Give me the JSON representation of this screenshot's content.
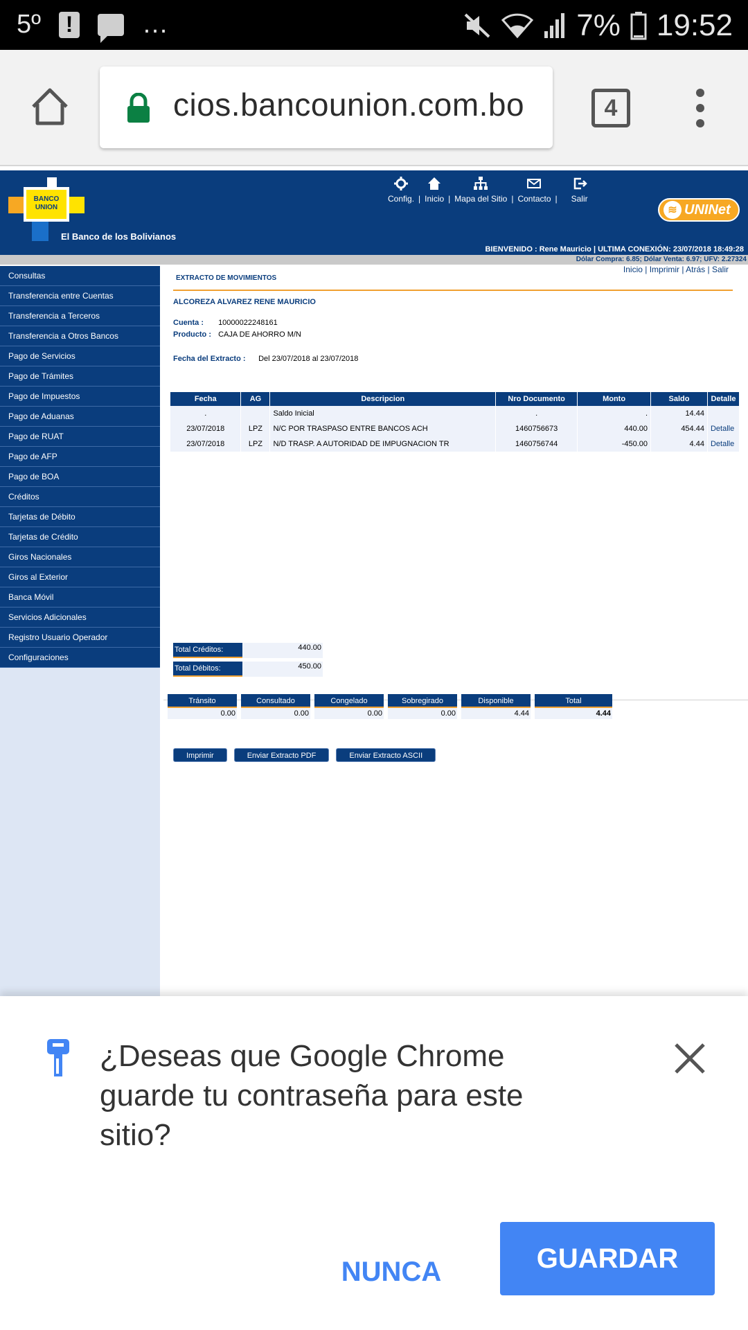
{
  "status_bar": {
    "left_text": "5º",
    "ellipsis": "…",
    "battery": "7%",
    "time": "19:52"
  },
  "chrome": {
    "url": "cios.bancounion.com.bo",
    "tab_count": "4"
  },
  "bank": {
    "logo_text": "BANCO UNION",
    "tagline": "El Banco de los Bolivianos",
    "nav": [
      {
        "label": "Config.",
        "sep": "|"
      },
      {
        "label": "Inicio",
        "sep": "|"
      },
      {
        "label": "Mapa del Sitio",
        "sep": "|"
      },
      {
        "label": "Contacto",
        "sep": "|"
      },
      {
        "label": "Salir",
        "sep": ""
      }
    ],
    "uninet": "UNINet",
    "welcome": "BIENVENIDO : Rene Mauricio | ULTIMA CONEXIÓN: 23/07/2018 18:49:28",
    "rates": "Dólar Compra: 6.85; Dólar Venta: 6.97; UFV: 2.27324",
    "sidebar": [
      "Consultas",
      "Transferencia entre Cuentas",
      "Transferencia a Terceros",
      "Transferencia a Otros Bancos",
      "Pago de Servicios",
      "Pago de Trámites",
      "Pago de Impuestos",
      "Pago de Aduanas",
      "Pago de RUAT",
      "Pago de AFP",
      "Pago de BOA",
      "Créditos",
      "Tarjetas de Débito",
      "Tarjetas de Crédito",
      "Giros Nacionales",
      "Giros al Exterior",
      "Banca Móvil",
      "Servicios Adicionales",
      "Registro Usuario Operador",
      "Configuraciones"
    ],
    "toplinks": {
      "inicio": "Inicio",
      "imprimir": "Imprimir",
      "atras": "Atrás",
      "salir": "Salir",
      "sep": " | "
    },
    "section_title": "EXTRACTO DE MOVIMIENTOS",
    "holder": "ALCOREZA ALVAREZ RENE MAURICIO",
    "cuenta_label": "Cuenta :",
    "cuenta_value": "10000022248161",
    "producto_label": "Producto :",
    "producto_value": "CAJA DE AHORRO M/N",
    "fecha_label": "Fecha del Extracto :",
    "fecha_value": "Del 23/07/2018 al 23/07/2018",
    "table": {
      "headers": [
        "Fecha",
        "AG",
        "Descripcion",
        "Nro Documento",
        "Monto",
        "Saldo",
        "Detalle"
      ],
      "rows": [
        {
          "fecha": ".",
          "ag": "",
          "desc": "Saldo Inicial",
          "doc": ".",
          "monto": ".",
          "saldo": "14.44",
          "detalle": ""
        },
        {
          "fecha": "23/07/2018",
          "ag": "LPZ",
          "desc": "N/C POR TRASPASO ENTRE BANCOS ACH",
          "doc": "1460756673",
          "monto": "440.00",
          "saldo": "454.44",
          "detalle": "Detalle"
        },
        {
          "fecha": "23/07/2018",
          "ag": "LPZ",
          "desc": "N/D TRASP. A AUTORIDAD DE IMPUGNACION TR",
          "doc": "1460756744",
          "monto": "-450.00",
          "saldo": "4.44",
          "detalle": "Detalle"
        }
      ]
    },
    "totals": {
      "creditos_label": "Total Créditos:",
      "creditos_value": "440.00",
      "debitos_label": "Total Débitos:",
      "debitos_value": "450.00"
    },
    "balances": [
      {
        "label": "Tránsito",
        "value": "0.00"
      },
      {
        "label": "Consultado",
        "value": "0.00"
      },
      {
        "label": "Congelado",
        "value": "0.00"
      },
      {
        "label": "Sobregirado",
        "value": "0.00"
      },
      {
        "label": "Disponible",
        "value": "4.44"
      },
      {
        "label": "Total",
        "value": "4.44"
      }
    ],
    "buttons": {
      "imprimir": "Imprimir",
      "pdf": "Enviar Extracto PDF",
      "ascii": "Enviar Extracto ASCII"
    }
  },
  "save_password": {
    "message": "¿Deseas que Google Chrome guarde tu contraseña para este sitio?",
    "never": "NUNCA",
    "save": "GUARDAR"
  },
  "colors": {
    "bank_blue": "#0a3d7d",
    "accent_orange": "#f0a030",
    "chrome_blue": "#4285f4"
  }
}
